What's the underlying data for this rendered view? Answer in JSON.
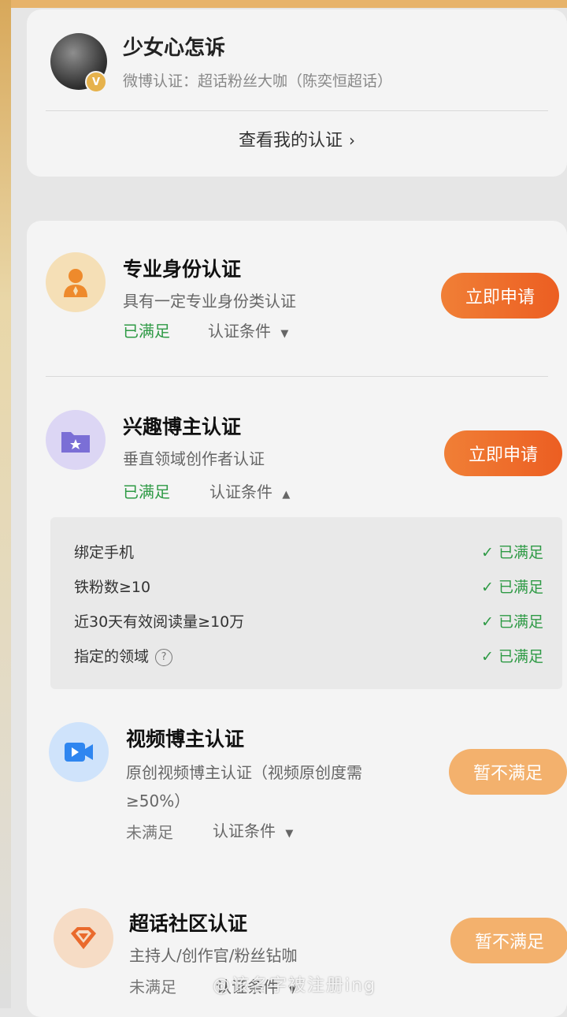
{
  "profile": {
    "username": "少女心怎诉",
    "verification": "微博认证：超话粉丝大咖（陈奕恒超话）",
    "view_certification": "查看我的认证"
  },
  "sections": [
    {
      "title": "专业身份认证",
      "description": "具有一定专业身份类认证",
      "status": "已满足",
      "conditions_label": "认证条件",
      "button": "立即申请",
      "icon": "person-icon"
    },
    {
      "title": "兴趣博主认证",
      "description": "垂直领域创作者认证",
      "status": "已满足",
      "conditions_label": "认证条件",
      "button": "立即申请",
      "icon": "folder-star-icon",
      "conditions": [
        {
          "label": "绑定手机",
          "status": "已满足"
        },
        {
          "label": "铁粉数≥10",
          "status": "已满足"
        },
        {
          "label": "近30天有效阅读量≥10万",
          "status": "已满足"
        },
        {
          "label": "指定的领域",
          "status": "已满足"
        }
      ]
    },
    {
      "title": "视频博主认证",
      "description_line1": "原创视频博主认证（视频原创度需",
      "description_line2": "≥50%）",
      "status": "未满足",
      "conditions_label": "认证条件",
      "button": "暂不满足",
      "icon": "video-icon"
    },
    {
      "title": "超话社区认证",
      "description": "主持人/创作官/粉丝钻咖",
      "status": "未满足",
      "conditions_label": "认证条件",
      "button": "暂不满足",
      "icon": "diamond-icon"
    }
  ],
  "watermark": "@该名字被注册ing",
  "colors": {
    "accent_orange": "#ec5e22",
    "success_green": "#2e9a45",
    "disabled_orange": "#f3b16d"
  }
}
